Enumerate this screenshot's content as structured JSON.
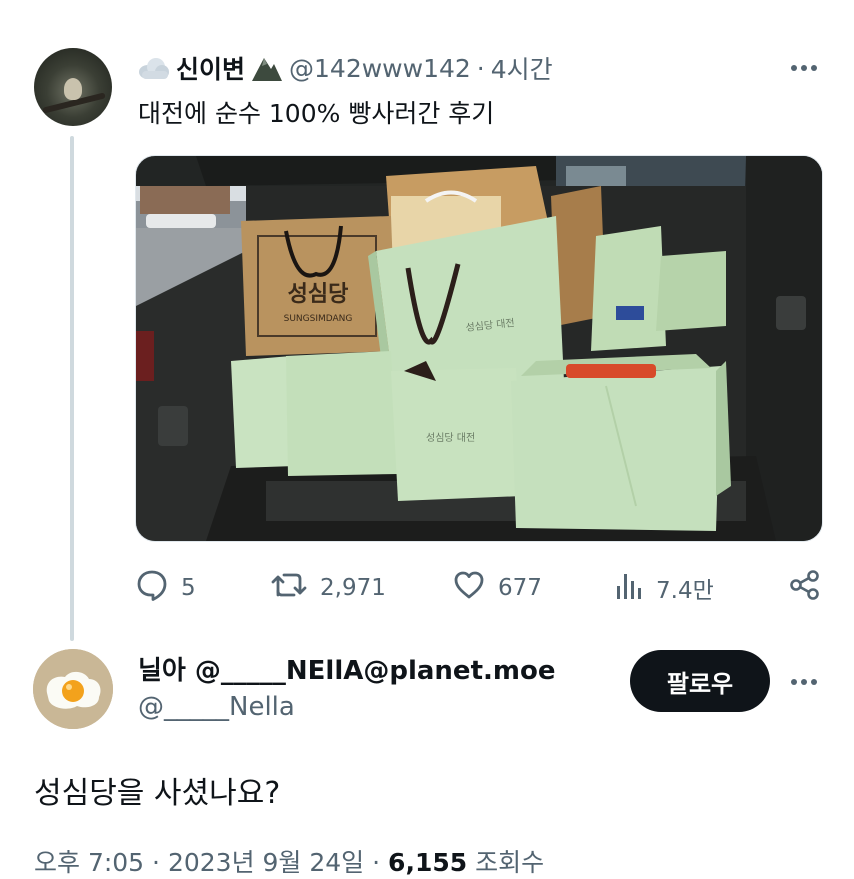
{
  "tweet": {
    "display_name": "신이변",
    "handle": "@142www142",
    "separator": "·",
    "time": "4시간",
    "text": "대전에 순수 100% 빵사러간 후기",
    "photo": {
      "bag_brand_korean": "성심당",
      "bag_brand_english": "SUNGSIMDANG"
    },
    "actions": {
      "replies": "5",
      "retweets": "2,971",
      "likes": "677",
      "views": "7.4만"
    }
  },
  "reply": {
    "name": "닐아 @_____NEllA@planet.moe",
    "handle": "@_____Nella",
    "follow_label": "팔로우",
    "text": "성심당을 사셨나요?",
    "time": "오후 7:05",
    "separator": "·",
    "date": "2023년 9월 24일",
    "separator2": "·",
    "views_count": "6,155",
    "views_label": "조회수"
  },
  "colors": {
    "text_primary": "#0f1419",
    "text_secondary": "#536471",
    "thread_line": "#cfd9de",
    "bag_green": "#c5e0bd",
    "bag_kraft": "#b9935f"
  },
  "icons": {
    "reply": "speech-bubble-icon",
    "retweet": "retweet-icon",
    "like": "heart-icon",
    "views": "bar-chart-icon",
    "share": "share-icon",
    "more": "more-dots-icon"
  }
}
